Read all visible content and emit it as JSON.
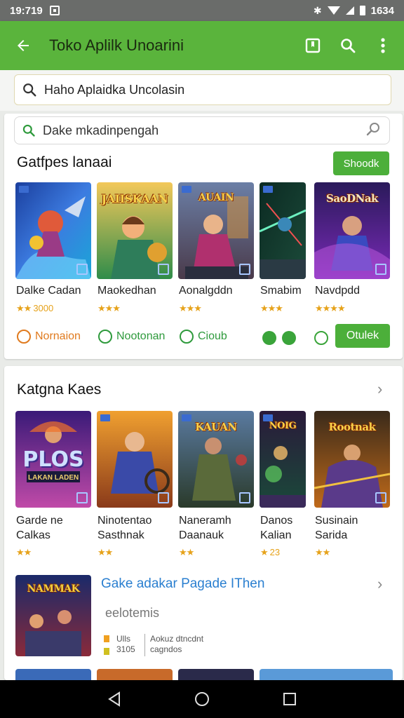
{
  "status_bar": {
    "time": "19:719",
    "right_text": "1634"
  },
  "app_bar": {
    "title": "Toko Aplilk Unoarini"
  },
  "top_search": {
    "text": "Haho Aplaidka Uncolasin"
  },
  "section1": {
    "search_text": "Dake mkadinpengah",
    "title": "Gatfpes lanaai",
    "action_button": "Shoodk",
    "games": [
      {
        "name": "Dalke Cadan",
        "stars": "★★",
        "rating_num": "3000",
        "banner": ""
      },
      {
        "name": "Maokedhan",
        "stars": "★★★",
        "rating_num": "",
        "banner": "JAIISKAAN"
      },
      {
        "name": "Aonalgddn",
        "stars": "★★★",
        "rating_num": "",
        "banner": "AUAIN"
      },
      {
        "name": "Smabim",
        "stars": "★★★",
        "rating_num": "",
        "banner": ""
      },
      {
        "name": "Navdpdd",
        "stars": "★★★★",
        "rating_num": "",
        "banner": "SaoDNak"
      }
    ],
    "chips": [
      {
        "label": "Nornaion",
        "color": "orange"
      },
      {
        "label": "Nootonan",
        "color": "green"
      },
      {
        "label": "Cioub",
        "color": "green"
      }
    ],
    "outline_button": "Otulek"
  },
  "section2": {
    "title": "Katgna Kaes",
    "games": [
      {
        "line1": "Garde ne",
        "line2": "Calkas",
        "stars": "★★",
        "rating_num": "",
        "banner": "PLOS",
        "sub": "LAKAN LADEN"
      },
      {
        "line1": "Ninotentao",
        "line2": "Sasthnak",
        "stars": "★★",
        "rating_num": "",
        "banner": "",
        "sub": ""
      },
      {
        "line1": "Naneramh",
        "line2": "Daanauk",
        "stars": "★★",
        "rating_num": "",
        "banner": "KAUAN",
        "sub": ""
      },
      {
        "line1": "Danos",
        "line2": "Kalian",
        "stars": "★",
        "rating_num": "23",
        "banner": "NOIG",
        "sub": ""
      },
      {
        "line1": "Susinain",
        "line2": "Sarida",
        "stars": "★★",
        "rating_num": "",
        "banner": "Rootnak",
        "sub": ""
      }
    ],
    "promo": {
      "title": "Gake adakar  Pagade IThen",
      "subtitle": "eelotemis",
      "banner": "NAMMAK",
      "meta": [
        {
          "label": "Ulls",
          "value": "Aokuz dtncdnt"
        },
        {
          "label": "3105",
          "value": "cagndos"
        }
      ]
    }
  }
}
